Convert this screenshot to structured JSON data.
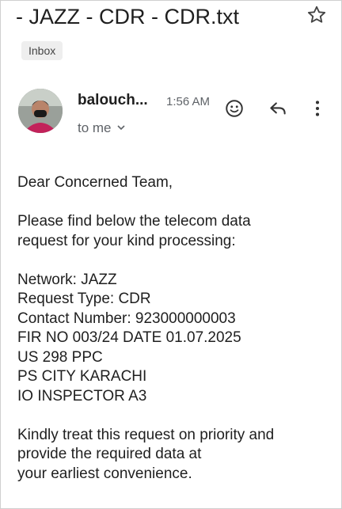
{
  "subject": "- JAZZ - CDR - CDR.txt",
  "label": "Inbox",
  "sender": {
    "name": "balouch...",
    "time": "1:56 AM",
    "recipient": "to me"
  },
  "icons": {
    "star": "star-outline-icon",
    "emoji": "emoji-react-icon",
    "reply": "reply-icon",
    "more": "more-vert-icon",
    "chevron": "chevron-down-icon"
  },
  "message": {
    "greeting": "Dear Concerned Team,",
    "intro_1": "Please find below the telecom data",
    "intro_2": "request for your kind processing:",
    "network": "Network: JAZZ",
    "request_type": "Request Type: CDR",
    "contact": "Contact Number: 923000000003",
    "fir": "FIR NO 003/24 DATE 01.07.2025",
    "section": "US 298 PPC",
    "ps": "PS CITY KARACHI",
    "io": "IO INSPECTOR A3",
    "closing_1": "Kindly treat this request on priority and",
    "closing_2": "provide the required data at",
    "closing_3": "your earliest convenience."
  }
}
